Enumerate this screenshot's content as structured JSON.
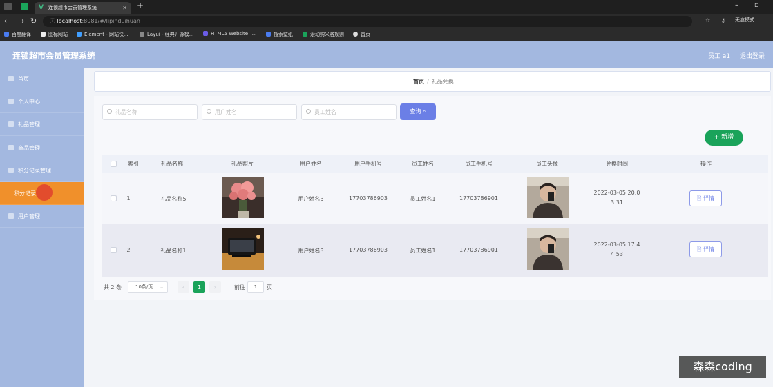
{
  "browser": {
    "tab_title": "连锁超市会员管理系统",
    "url_host": "localhost",
    "url_rest": ":8081/#/lipinduihuan",
    "profile_label": "无痕模式",
    "bookmarks": [
      "百度翻译",
      "图标网站",
      "Element - 网站快...",
      "Layui - 经典开源模...",
      "HTML5 Website T...",
      "搜索壁纸",
      "滚动购米名规则",
      "首页"
    ]
  },
  "header": {
    "title": "连锁超市会员管理系统",
    "user": "员工 a1",
    "logout": "退出登录"
  },
  "sidebar": {
    "items": [
      {
        "label": "首页"
      },
      {
        "label": "个人中心"
      },
      {
        "label": "礼品管理"
      },
      {
        "label": "商品管理"
      },
      {
        "label": "积分记录管理"
      },
      {
        "label": "积分记录"
      },
      {
        "label": "用户管理"
      }
    ]
  },
  "breadcrumb": {
    "home": "首页",
    "separator": "/",
    "current": "礼品兑换"
  },
  "search": {
    "gift_name_placeholder": "礼品名称",
    "user_name_placeholder": "用户姓名",
    "employee_name_placeholder": "员工姓名",
    "query_label": "查询"
  },
  "actions": {
    "add_label": "+ 新增"
  },
  "table": {
    "columns": [
      "索引",
      "礼品名称",
      "礼品照片",
      "用户姓名",
      "用户手机号",
      "员工姓名",
      "员工手机号",
      "员工头像",
      "兑换时间",
      "操作"
    ],
    "rows": [
      {
        "index": "1",
        "gift_name": "礼品名称5",
        "user_name": "用户姓名3",
        "user_phone": "17703786903",
        "employee_name": "员工姓名1",
        "employee_phone": "17703786901",
        "time_line1": "2022-03-05 20:0",
        "time_line2": "3:31",
        "detail_label": "详情"
      },
      {
        "index": "2",
        "gift_name": "礼品名称1",
        "user_name": "用户姓名3",
        "user_phone": "17703786903",
        "employee_name": "员工姓名1",
        "employee_phone": "17703786901",
        "time_line1": "2022-03-05 17:4",
        "time_line2": "4:53",
        "detail_label": "详情"
      }
    ]
  },
  "pagination": {
    "total": "共 2 条",
    "page_size": "10条/页",
    "current_page": "1",
    "goto_prefix": "前往",
    "goto_value": "1",
    "goto_suffix": "页"
  },
  "watermark": "森森coding",
  "colors": {
    "header_bg": "#a3b8e0",
    "active_menu": "#f0902b",
    "primary_button": "#6b7fe6",
    "add_button": "#1aa35a"
  }
}
